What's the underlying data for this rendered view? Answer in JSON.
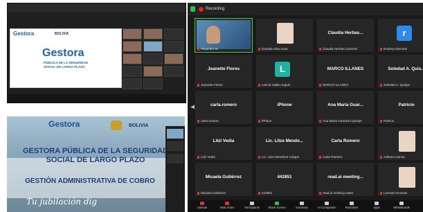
{
  "left_top_panel": {
    "logo": "Gestora",
    "subtitle": "PÚBLICA DE LA SEGURIDAD SOCIAL DE LARGO PLAZO",
    "bolivia_label": "BOLIVIA"
  },
  "left_bottom_slide": {
    "logo": "Gestora",
    "bolivia_label": "BOLIVIA",
    "title": "GESTORA PÚBLICA DE LA SEGURIDAD SOCIAL DE LARGO PLAZO",
    "subtitle": "GESTIÓN ADMINISTRATIVA DE COBRO",
    "tagline": "Tu jubilación dig"
  },
  "zoom": {
    "recording_label": "Recording",
    "active_speaker_caption": "Alejandro M.",
    "tiles": [
      {
        "name": "",
        "caption": "Alejandro M.",
        "type": "video"
      },
      {
        "name": "",
        "caption": "Daniela Silva Soto",
        "type": "photo"
      },
      {
        "name": "Claudia Herbas...",
        "caption": "Claudia Herbas Caceres",
        "type": "name"
      },
      {
        "name": "",
        "caption": "Rodney Ramirez",
        "type": "letter",
        "letter": "r",
        "color": "#2d8ceb"
      },
      {
        "name": "Jeanette Flores",
        "caption": "Jeanette Flores",
        "type": "name"
      },
      {
        "name": "",
        "caption": "Leticia Valda Angulo",
        "type": "letter",
        "letter": "L",
        "color": "#1fb3a6"
      },
      {
        "name": "MARCO ILLANES",
        "caption": "MARCO ILLANES",
        "type": "name"
      },
      {
        "name": "Soledad A. Quis...",
        "caption": "Soledad A. Quispe",
        "type": "name"
      },
      {
        "name": "carla.romero",
        "caption": "carla.romero",
        "type": "name"
      },
      {
        "name": "iPhone",
        "caption": "iPhone",
        "type": "name"
      },
      {
        "name": "Ana Maria Guar...",
        "caption": "Ana Maria Guarachi Quispe",
        "type": "name"
      },
      {
        "name": "Patricio",
        "caption": "Patricio",
        "type": "name"
      },
      {
        "name": "Litzi Vedia",
        "caption": "Litzi Vedia",
        "type": "name"
      },
      {
        "name": "Lic. Litze Mendo...",
        "caption": "Lic. Litze Mendoza Colque",
        "type": "name"
      },
      {
        "name": "Carla Romero",
        "caption": "Carla Romero",
        "type": "name"
      },
      {
        "name": "",
        "caption": "Adriana Garcia",
        "type": "photo"
      },
      {
        "name": "Micaela Gutiérrez",
        "caption": "Micaela Gutiérrez",
        "type": "name"
      },
      {
        "name": "442851",
        "caption": "442851",
        "type": "name"
      },
      {
        "name": "read.ai meeting...",
        "caption": "read.ai meeting notes",
        "type": "name"
      },
      {
        "name": "",
        "caption": "Lorraine Encinas",
        "type": "photo"
      }
    ],
    "toolbar": [
      {
        "label": "Unmute",
        "icon": "microphone-icon"
      },
      {
        "label": "Start Video",
        "icon": "video-camera-icon"
      },
      {
        "label": "Participants",
        "icon": "participants-icon"
      },
      {
        "label": "Share Screen",
        "icon": "share-screen-icon"
      },
      {
        "label": "Summary",
        "icon": "summary-icon"
      },
      {
        "label": "AI Companion",
        "icon": "ai-companion-icon"
      },
      {
        "label": "Reactions",
        "icon": "reactions-icon"
      },
      {
        "label": "Apps",
        "icon": "apps-icon"
      },
      {
        "label": "Whiteboards",
        "icon": "whiteboard-icon"
      }
    ]
  }
}
